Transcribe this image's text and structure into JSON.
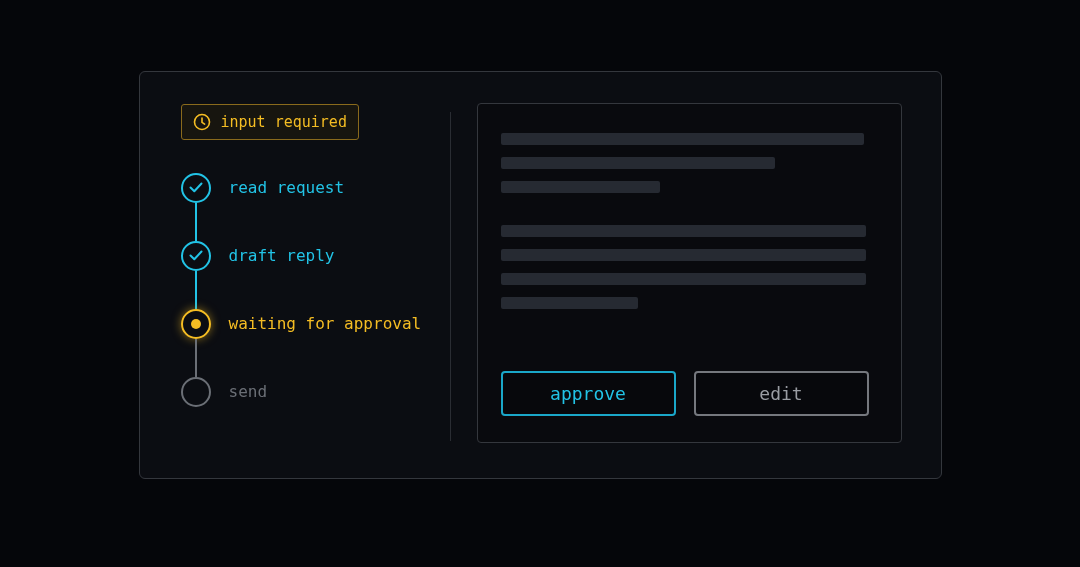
{
  "status_badge": {
    "label": "input required"
  },
  "steps": [
    {
      "label": "read request",
      "kind": "done"
    },
    {
      "label": "draft reply",
      "kind": "done"
    },
    {
      "label": "waiting for approval",
      "kind": "current"
    },
    {
      "label": "send",
      "kind": "pending"
    }
  ],
  "actions": [
    {
      "label": "approve",
      "kind": "primary"
    },
    {
      "label": "edit",
      "kind": "secondary"
    }
  ]
}
